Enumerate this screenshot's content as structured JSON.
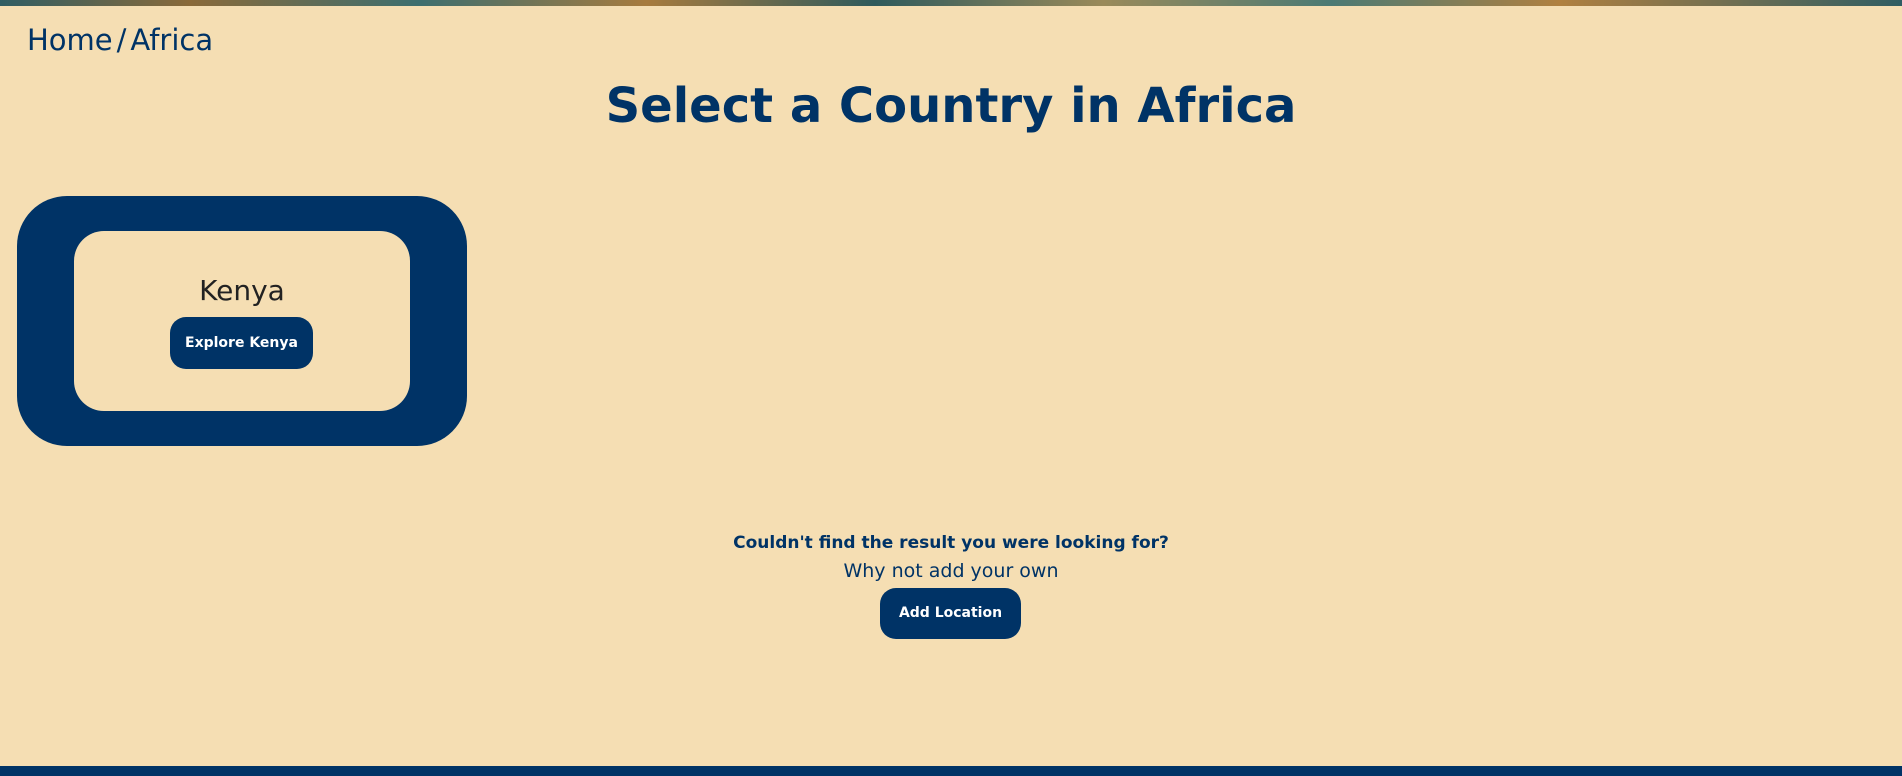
{
  "breadcrumb": {
    "home": "Home",
    "separator": "/",
    "current": "Africa"
  },
  "page": {
    "title": "Select a Country in Africa"
  },
  "countries": [
    {
      "name": "Kenya",
      "button_label": "Explore Kenya"
    }
  ],
  "cta": {
    "question": "Couldn't find the result you were looking for?",
    "prompt": "Why not add your own",
    "button_label": "Add Location"
  },
  "colors": {
    "background": "#f5deb3",
    "primary": "#003366"
  }
}
